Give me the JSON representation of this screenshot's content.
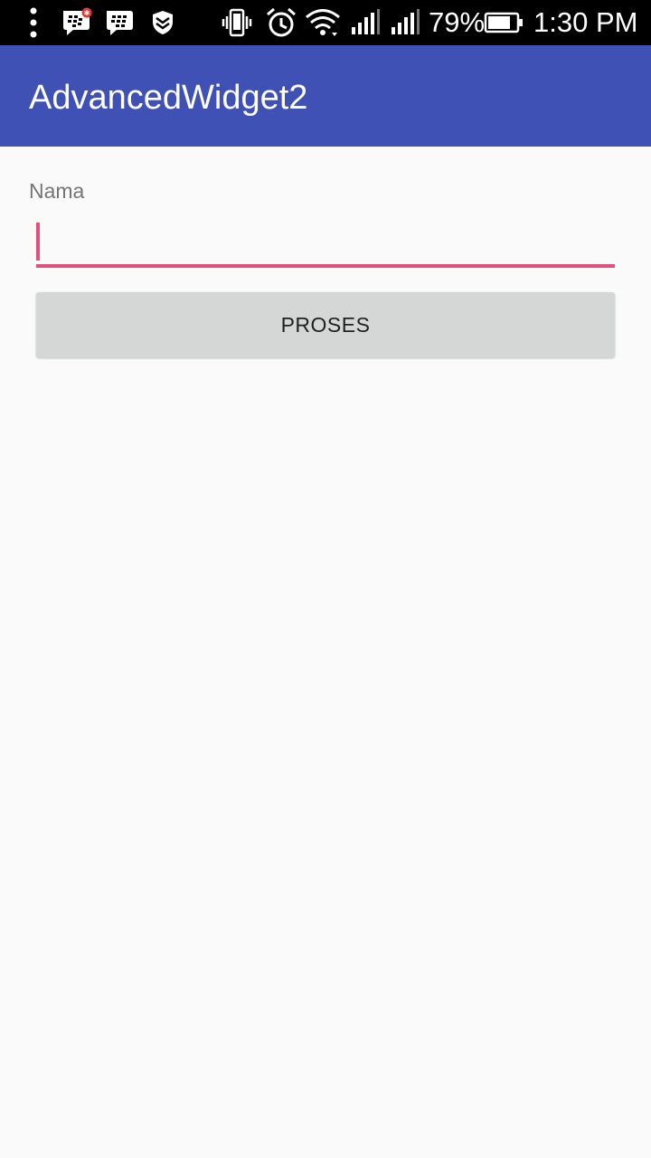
{
  "status_bar": {
    "battery_percent": "79%",
    "time": "1:30 PM",
    "icons": [
      "more-vert-icon",
      "bbm-notification-icon",
      "bbm-icon",
      "shield-icon",
      "vibrate-icon",
      "alarm-icon",
      "wifi-icon",
      "signal-icon",
      "signal-icon",
      "battery-icon"
    ]
  },
  "app_bar": {
    "title": "AdvancedWidget2",
    "color": "#3f51b5"
  },
  "form": {
    "name_label": "Nama",
    "name_value": "",
    "accent_color": "#e4507e",
    "submit_label": "PROSES"
  }
}
